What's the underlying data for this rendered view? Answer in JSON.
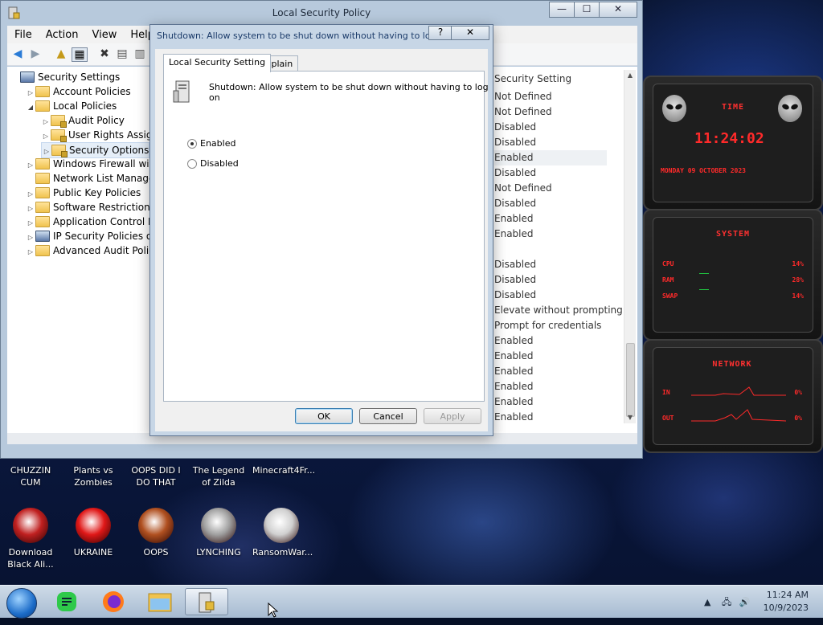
{
  "main_window": {
    "title": "Local Security Policy",
    "controls": {
      "minimize": "—",
      "maximize": "☐",
      "close": "✕"
    },
    "menu": [
      "File",
      "Action",
      "View",
      "Help"
    ],
    "tree": [
      {
        "label": "Security Settings",
        "depth": 0,
        "expander": "",
        "icon": "shield-folder"
      },
      {
        "label": "Account Policies",
        "depth": 1,
        "expander": "▷",
        "icon": "folder"
      },
      {
        "label": "Local Policies",
        "depth": 1,
        "expander": "◢",
        "icon": "folder"
      },
      {
        "label": "Audit Policy",
        "depth": 2,
        "expander": "▷",
        "icon": "lock-folder"
      },
      {
        "label": "User Rights Assignment",
        "depth": 2,
        "expander": "▷",
        "icon": "lock-folder"
      },
      {
        "label": "Security Options",
        "depth": 2,
        "expander": "▷",
        "icon": "lock-folder",
        "selected": true
      },
      {
        "label": "Windows Firewall with Advanced Security",
        "depth": 1,
        "expander": "▷",
        "icon": "folder"
      },
      {
        "label": "Network List Manager Policies",
        "depth": 1,
        "expander": "",
        "icon": "folder"
      },
      {
        "label": "Public Key Policies",
        "depth": 1,
        "expander": "▷",
        "icon": "folder"
      },
      {
        "label": "Software Restriction Policies",
        "depth": 1,
        "expander": "▷",
        "icon": "folder"
      },
      {
        "label": "Application Control Policies",
        "depth": 1,
        "expander": "▷",
        "icon": "folder"
      },
      {
        "label": "IP Security Policies on Local Computer",
        "depth": 1,
        "expander": "▷",
        "icon": "shield-folder"
      },
      {
        "label": "Advanced Audit Policy Configuration",
        "depth": 1,
        "expander": "▷",
        "icon": "folder"
      }
    ],
    "list_header": "Security Setting",
    "settings": [
      "Not Defined",
      "Not Defined",
      "Disabled",
      "Disabled",
      "Enabled",
      "Disabled",
      "Not Defined",
      "Disabled",
      "Enabled",
      "Enabled",
      "",
      "Disabled",
      "Disabled",
      "Disabled",
      "Elevate without prompting",
      "Prompt for credentials",
      "Enabled",
      "Enabled",
      "Enabled",
      "Enabled",
      "Enabled",
      "Enabled"
    ]
  },
  "dialog": {
    "title": "Shutdown: Allow system to be shut down without having to log on ...",
    "help": "?",
    "close": "✕",
    "tabs": [
      "Local Security Setting",
      "Explain"
    ],
    "policy_name": "Shutdown: Allow system to be shut down without having to log on",
    "options": [
      {
        "label": "Enabled",
        "checked": true
      },
      {
        "label": "Disabled",
        "checked": false
      }
    ],
    "buttons": {
      "ok": "OK",
      "cancel": "Cancel",
      "apply": "Apply"
    }
  },
  "gadgets": {
    "time": {
      "title": "TIME",
      "clock": "11:24:02",
      "date": "MONDAY 09 OCTOBER 2023"
    },
    "system": {
      "title": "SYSTEM",
      "rows": [
        {
          "label": "CPU",
          "value": "14%"
        },
        {
          "label": "RAM",
          "value": "28%"
        },
        {
          "label": "SWAP",
          "value": "14%"
        }
      ]
    },
    "network": {
      "title": "NETWORK",
      "rows": [
        {
          "label": "IN",
          "value": "0%"
        },
        {
          "label": "OUT",
          "value": "0%"
        }
      ]
    }
  },
  "desktop_icons_top": [
    {
      "label": "CHUZZIN CUM"
    },
    {
      "label": "Plants vs Zombies"
    },
    {
      "label": "OOPS DID I DO THAT"
    },
    {
      "label": "The Legend of Zilda"
    },
    {
      "label": "Minecraft4Fr..."
    }
  ],
  "desktop_icons": [
    {
      "label": "Download Black Ali...",
      "color": "#c02020"
    },
    {
      "label": "UKRAINE",
      "color": "#e01818"
    },
    {
      "label": "OOPS",
      "color": "#b05020"
    },
    {
      "label": "LYNCHING",
      "color": "#a0a0a0"
    },
    {
      "label": "RansomWar...",
      "color": "#d0d0d0"
    }
  ],
  "taskbar": {
    "time": "11:24 AM",
    "date": "10/9/2023",
    "tray_expand": "▲"
  }
}
